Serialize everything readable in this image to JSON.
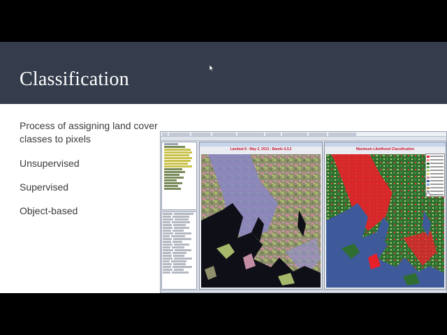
{
  "slide": {
    "title": "Classification",
    "bullets": [
      "Process of assigning land cover classes to pixels",
      "Unsupervised",
      "Supervised",
      "Object-based"
    ]
  },
  "screenshot": {
    "left_view": {
      "title": "Landsat 8 : May 2, 2013 : Bands 4,3,2"
    },
    "right_view": {
      "title": "Maximum Likelihood Classification"
    }
  },
  "colors": {
    "title_bar": "#353d4d",
    "water": "#2a3f74",
    "urban": "#e8202a",
    "forest": "#2d6b2d",
    "view_title": "#c8102e"
  },
  "icons": [
    "mouse-cursor-icon"
  ]
}
